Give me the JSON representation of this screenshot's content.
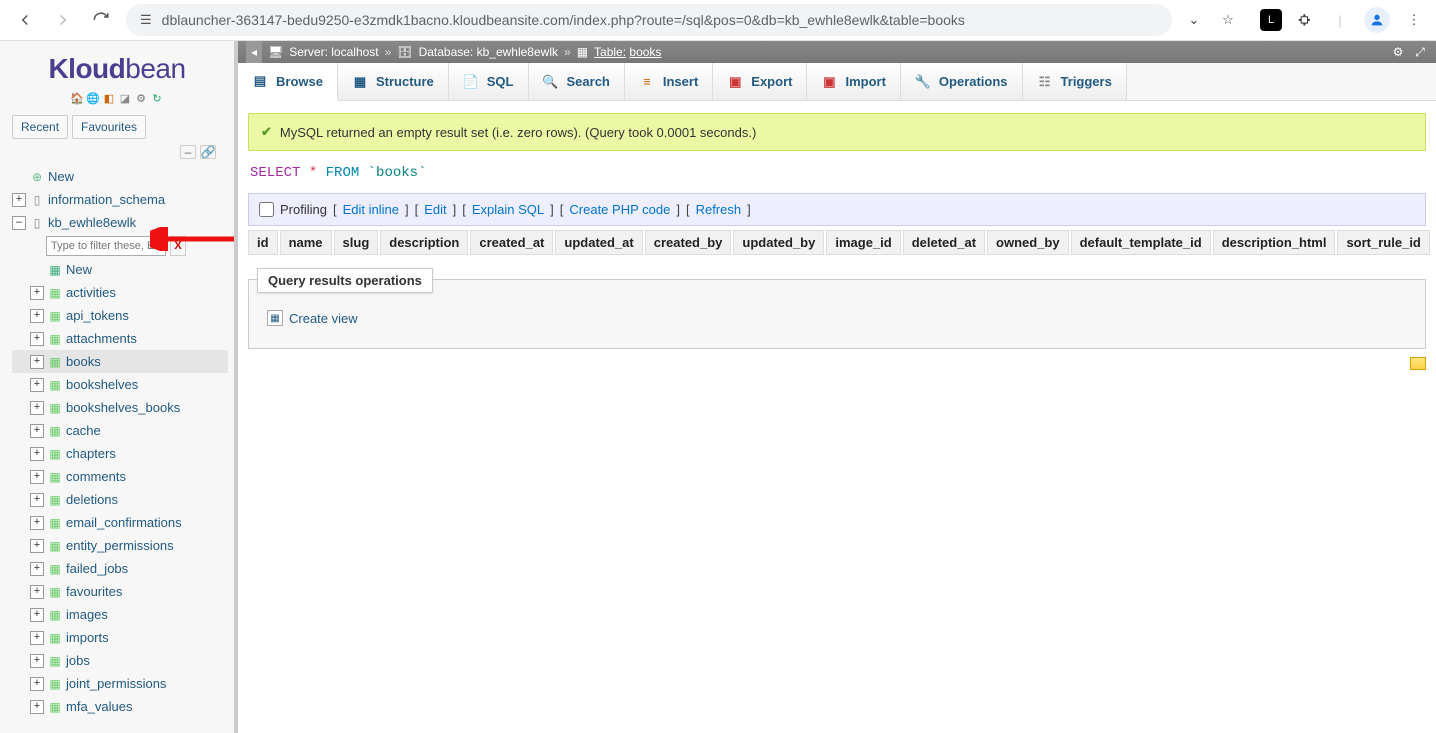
{
  "browser": {
    "url_host": "dblauncher-363147-bedu9250-e3zmdk1bacno.kloudbeansite.com",
    "url_path": "/index.php?route=/sql&pos=0&db=kb_ewhle8ewlk&table=books"
  },
  "logo": {
    "part1": "Kloud",
    "part2": "bean"
  },
  "sidebar": {
    "recent": "Recent",
    "favourites": "Favourites",
    "new_top": "New",
    "information_schema": "information_schema",
    "active_db": "kb_ewhle8ewlk",
    "filter_placeholder": "Type to filter these, Enter to s",
    "filter_clear": "X",
    "new_inner": "New",
    "tables": [
      "activities",
      "api_tokens",
      "attachments",
      "books",
      "bookshelves",
      "bookshelves_books",
      "cache",
      "chapters",
      "comments",
      "deletions",
      "email_confirmations",
      "entity_permissions",
      "failed_jobs",
      "favourites",
      "images",
      "imports",
      "jobs",
      "joint_permissions",
      "mfa_values"
    ],
    "selected_table": "books"
  },
  "breadcrumb": {
    "server_label": "Server:",
    "server_value": "localhost",
    "database_label": "Database:",
    "database_value": "kb_ewhle8ewlk",
    "table_label": "Table:",
    "table_value": "books"
  },
  "tabs": {
    "browse": "Browse",
    "structure": "Structure",
    "sql": "SQL",
    "search": "Search",
    "insert": "Insert",
    "export": "Export",
    "import": "Import",
    "operations": "Operations",
    "triggers": "Triggers"
  },
  "message": "MySQL returned an empty result set (i.e. zero rows). (Query took 0.0001 seconds.)",
  "sql": {
    "select": "SELECT",
    "star": "*",
    "from": "FROM",
    "tbl": "`books`"
  },
  "links": {
    "profiling": "Profiling",
    "edit_inline": "Edit inline",
    "edit": "Edit",
    "explain": "Explain SQL",
    "create_php": "Create PHP code",
    "refresh": "Refresh"
  },
  "columns": [
    "id",
    "name",
    "slug",
    "description",
    "created_at",
    "updated_at",
    "created_by",
    "updated_by",
    "image_id",
    "deleted_at",
    "owned_by",
    "default_template_id",
    "description_html",
    "sort_rule_id"
  ],
  "qops": {
    "legend": "Query results operations",
    "create_view": "Create view"
  }
}
